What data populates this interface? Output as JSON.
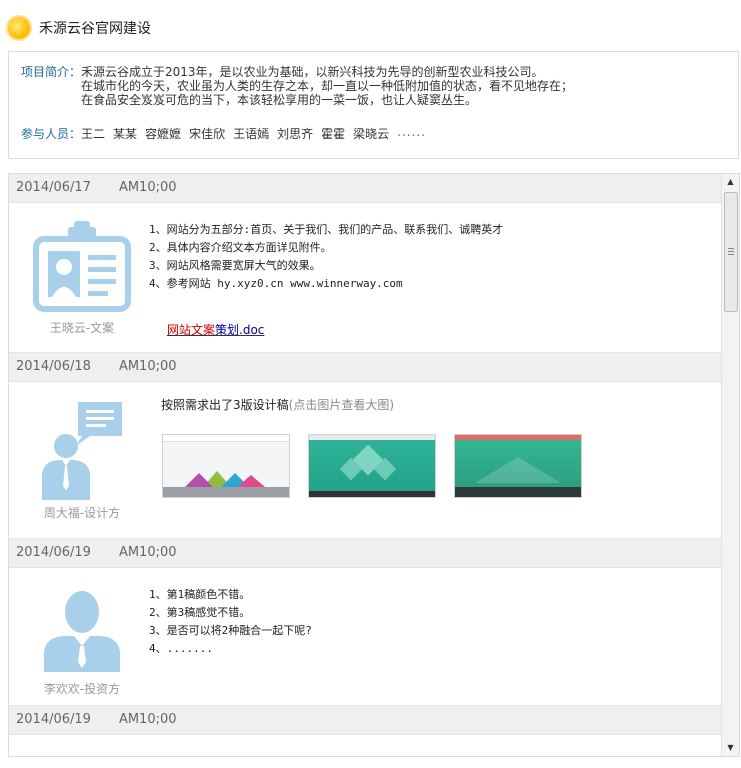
{
  "header": {
    "title": "禾源云谷官网建设",
    "icon": "sun-icon"
  },
  "project": {
    "intro_label": "项目简介：",
    "intro_lines": [
      "禾源云谷成立于2013年，是以农业为基础，以新兴科技为先导的创新型农业科技公司。",
      "在城市化的今天，农业虽为人类的生存之本，却一直以一种低附加值的状态，看不见地存在；",
      "在食品安全岌岌可危的当下，本该轻松享用的一菜一饭，也让人疑窦丛生。"
    ],
    "members_label": "参与人员：",
    "members": [
      "王二",
      "某某",
      "容嬷嬷",
      "宋佳欣",
      "王语嫣",
      "刘思齐",
      "霍霍",
      "梁晓云",
      "......"
    ]
  },
  "posts": [
    {
      "date": "2014/06/17",
      "time": "AM10;00",
      "author": "王晓云-文案",
      "avatar": "id-badge-icon",
      "lines": [
        "1、网站分为五部分:首页、关于我们、我们的产品、联系我们、诚聘英才",
        "2、具体内容介绍文本方面详见附件。",
        "3、网站风格需要宽屏大气的效果。",
        "4、参考网站 hy.xyz0.cn www.winnerway.com"
      ],
      "attachment_red": "网站文案",
      "attachment_blue": "策划.doc"
    },
    {
      "date": "2014/06/18",
      "time": "AM10;00",
      "author": "周大福-设计方",
      "avatar": "presenter-icon",
      "text": "按照需求出了3版设计稿",
      "hint": "(点击图片查看大图)"
    },
    {
      "date": "2014/06/19",
      "time": "AM10;00",
      "author": "李欢欢-投资方",
      "avatar": "investor-icon",
      "lines": [
        "1、第1稿颜色不错。",
        "2、第3稿感觉不错。",
        "3、是否可以将2种融合一起下呢?",
        "4、......."
      ]
    },
    {
      "date": "2014/06/19",
      "time": "AM10;00"
    }
  ],
  "colors": {
    "label_blue": "#1d6a98",
    "avatar_blue": "#a8d0ea",
    "link_red": "#cc0000",
    "link_blue": "#000099"
  }
}
